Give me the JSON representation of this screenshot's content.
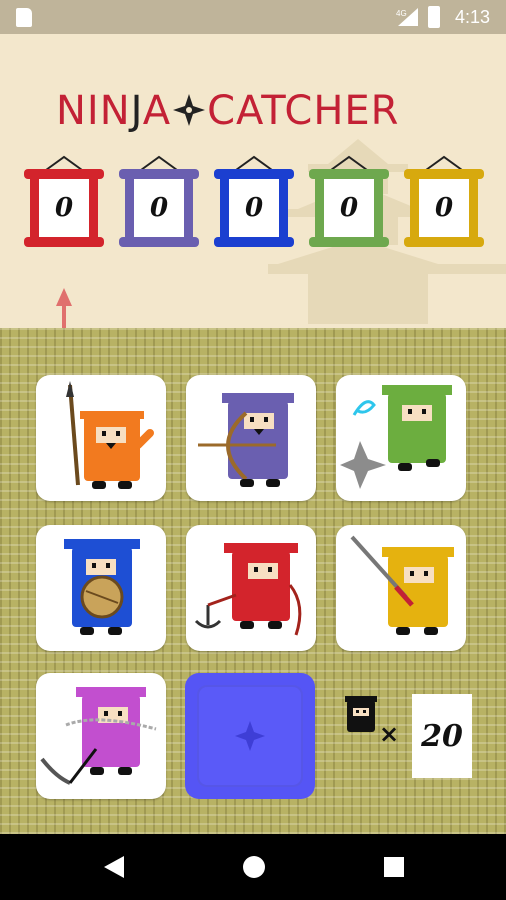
{
  "status_bar": {
    "network": "4G",
    "time": "4:13"
  },
  "app": {
    "title_part1": "NIN",
    "title_j": "J",
    "title_part2": "A",
    "title_part3": "CATCHER",
    "title_color": "#c32135"
  },
  "scores": [
    {
      "color": "red",
      "hex": "#d3242c",
      "value": "0"
    },
    {
      "color": "purple",
      "hex": "#6a5fb0",
      "value": "0"
    },
    {
      "color": "blue",
      "hex": "#1b3fd0",
      "value": "0"
    },
    {
      "color": "green",
      "hex": "#6ea84e",
      "value": "0"
    },
    {
      "color": "yellow",
      "hex": "#d7a90e",
      "value": "0"
    }
  ],
  "ninjas": [
    {
      "name": "orange-spear-ninja",
      "color": "#f27a1f",
      "weapon": "spear"
    },
    {
      "name": "purple-bow-ninja",
      "color": "#6a5fb0",
      "weapon": "bow"
    },
    {
      "name": "green-shuriken-ninja",
      "color": "#6cae3f",
      "weapon": "shuriken"
    },
    {
      "name": "blue-drum-ninja",
      "color": "#1e4fd4",
      "weapon": "drum"
    },
    {
      "name": "red-grapple-ninja",
      "color": "#d3242c",
      "weapon": "grappling-hook"
    },
    {
      "name": "yellow-katana-ninja",
      "color": "#e5b20f",
      "weapon": "katana"
    },
    {
      "name": "pink-kusarigama-ninja",
      "color": "#c24fcf",
      "weapon": "kusarigama"
    }
  ],
  "selected_tile": {
    "color": "#5555f5",
    "icon": "star-icon"
  },
  "remaining": {
    "icon": "ninja-head-icon",
    "multiplier": "×",
    "count": "20"
  },
  "nav": {
    "back": "back-icon",
    "home": "home-icon",
    "recent": "recent-apps-icon"
  }
}
